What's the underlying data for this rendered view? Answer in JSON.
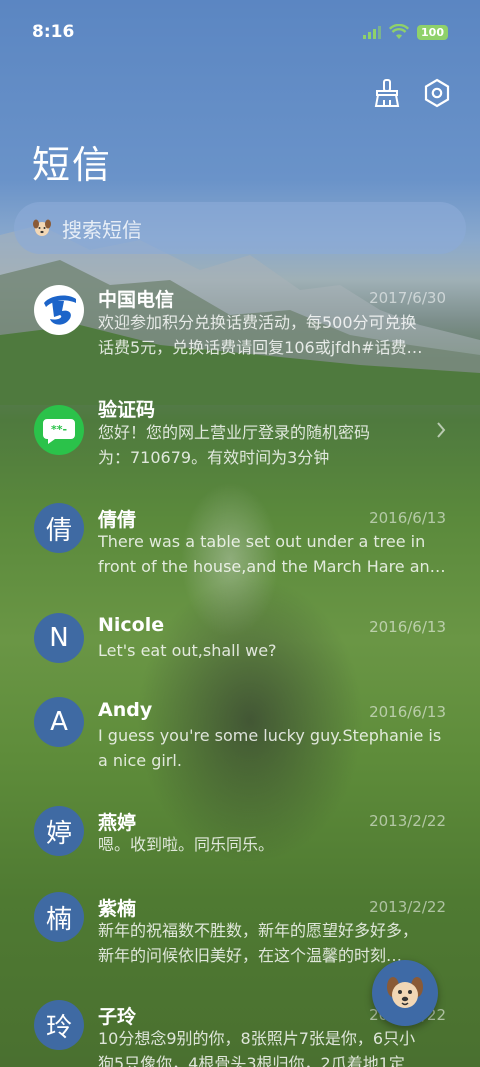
{
  "status": {
    "time": "8:16",
    "battery": "100"
  },
  "header": {
    "title": "短信",
    "icons": [
      "broom-icon",
      "settings-hexagon-icon"
    ]
  },
  "search": {
    "placeholder": "搜索短信",
    "icon": "dog-icon"
  },
  "conversations": [
    {
      "avatar": "chinatelecom-logo",
      "name": "中国电信",
      "date": "2017/6/30",
      "lines": [
        "欢迎参加积分兑换话费活动，每500分可兑换",
        "话费5元，兑换话费请回复106或jfdh#话费…"
      ]
    },
    {
      "avatar": "chat-bubble-logo",
      "name": "验证码",
      "date": "",
      "lines": [
        "您好！您的网上营业厅登录的随机密码",
        "为：710679。有效时间为3分钟"
      ]
    },
    {
      "avatar": "倩",
      "name": "倩倩",
      "date": "2016/6/13",
      "lines": [
        "There was a table set out under a tree in",
        "front of the house,and the March Hare an…"
      ]
    },
    {
      "avatar": "N",
      "name": "Nicole",
      "date": "2016/6/13",
      "lines": [
        "Let's eat out,shall we?"
      ]
    },
    {
      "avatar": "A",
      "name": "Andy",
      "date": "2016/6/13",
      "lines": [
        "I guess you're some lucky guy.Stephanie is",
        "a nice girl."
      ]
    },
    {
      "avatar": "婷",
      "name": "燕婷",
      "date": "2013/2/22",
      "lines": [
        "嗯。收到啦。同乐同乐。"
      ]
    },
    {
      "avatar": "楠",
      "name": "紫楠",
      "date": "2013/2/22",
      "lines": [
        "新年的祝福数不胜数，新年的愿望好多好多，",
        "新年的问候依旧美好，在这个温馨的时刻…"
      ]
    },
    {
      "avatar": "玲",
      "name": "子玲",
      "date": "2013/2/22",
      "lines": [
        "10分想念9别的你，8张照片7张是你，6只小",
        "狗5只像你，4根骨头3根归你，2爪着地1定…"
      ]
    }
  ],
  "fab": {
    "icon": "dog-icon"
  },
  "colors": {
    "accent": "#3f6aa3",
    "chinatelecom": "#1c64c9",
    "wechat_green": "#2bc24a"
  }
}
